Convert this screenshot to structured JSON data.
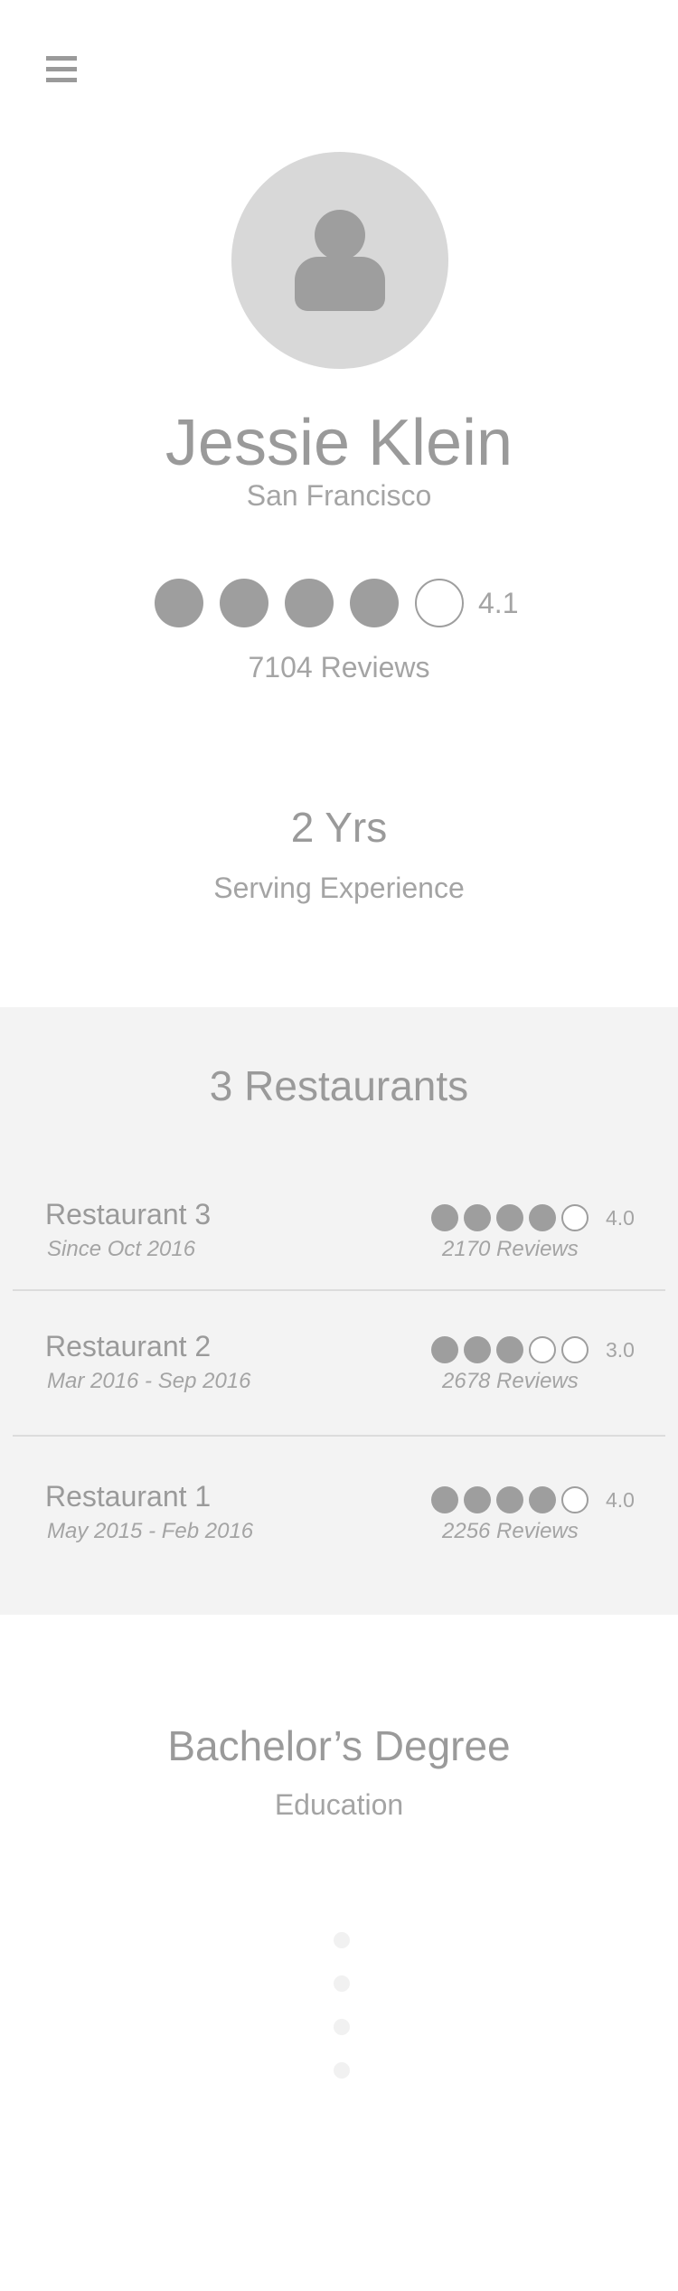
{
  "header": {
    "menu_icon": "hamburger-menu-icon"
  },
  "profile": {
    "avatar_icon": "user-silhouette-icon",
    "name": "Jessie Klein",
    "city": "San Francisco",
    "rating": {
      "value": 4.1,
      "label": "4.1",
      "filled": 4,
      "total": 5
    },
    "reviews": "7104 Reviews"
  },
  "experience": {
    "value": "2 Yrs",
    "label": "Serving Experience"
  },
  "restaurants": {
    "title": "3 Restaurants",
    "items": [
      {
        "name": "Restaurant 3",
        "dates": "Since Oct  2016",
        "rating_label": "4.0",
        "filled": 4,
        "total": 5,
        "reviews": "2170 Reviews"
      },
      {
        "name": "Restaurant 2",
        "dates": "Mar 2016 - Sep 2016",
        "rating_label": "3.0",
        "filled": 3,
        "total": 5,
        "reviews": "2678 Reviews"
      },
      {
        "name": "Restaurant 1",
        "dates": "May 2015 - Feb 2016",
        "rating_label": "4.0",
        "filled": 4,
        "total": 5,
        "reviews": "2256 Reviews"
      }
    ]
  },
  "education": {
    "value": "Bachelor’s Degree",
    "label": "Education"
  },
  "loading": {
    "icon": "loading-dots-icon",
    "dot_count": 4
  },
  "colors": {
    "text": "#9a9a9a",
    "dot_fill": "#9e9e9e",
    "avatar_bg": "#d8d8d8",
    "panel_bg": "#f3f3f3"
  }
}
